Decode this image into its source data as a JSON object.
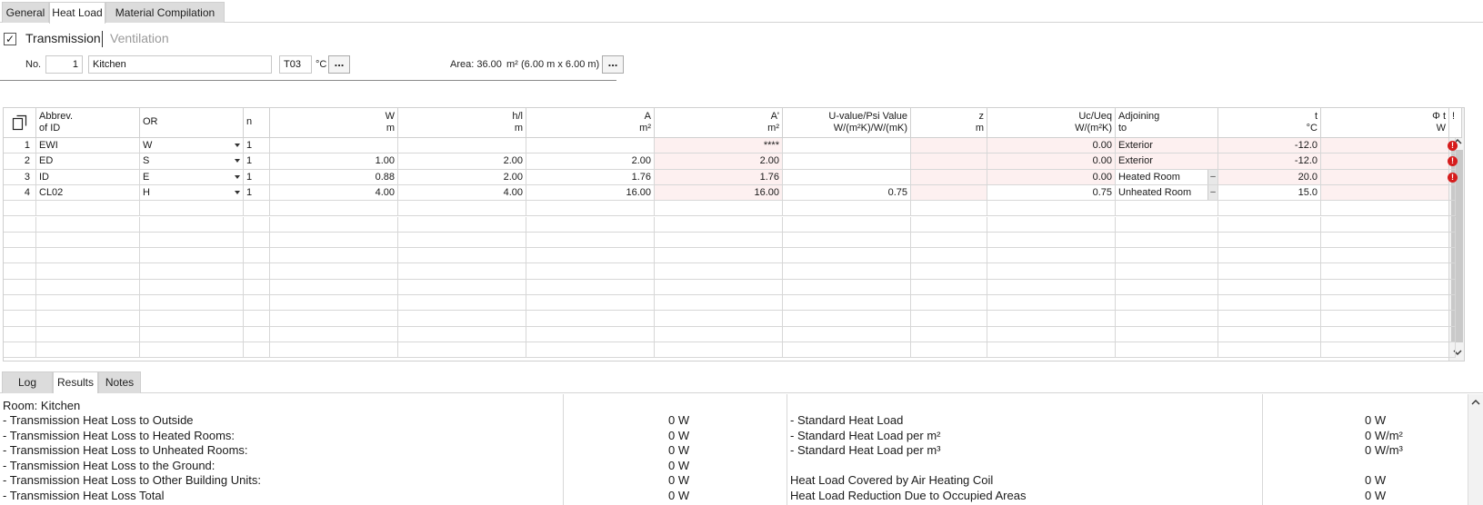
{
  "tabs": [
    "General",
    "Heat Load",
    "Material Compilation"
  ],
  "subtabs": {
    "transmission": "Transmission",
    "ventilation": "Ventilation",
    "checkbox": "✓"
  },
  "room": {
    "no_label": "No.",
    "no": "1",
    "name": "Kitchen",
    "temp_code": "T03",
    "temp_unit": "°C",
    "dots": "...",
    "area_label": "Area: 36.00",
    "area_unit": "m²",
    "area_dims": "(6.00 m x 6.00 m)"
  },
  "grid": {
    "copy_icon": "copy-icon",
    "headers": [
      {
        "l1": "Abbrev.",
        "l2": "of ID"
      },
      {
        "l1": "OR",
        "l2": ""
      },
      {
        "l1": "n",
        "l2": ""
      },
      {
        "l1": "W",
        "l2": "m"
      },
      {
        "l1": "h/l",
        "l2": "m"
      },
      {
        "l1": "A",
        "l2": "m²"
      },
      {
        "l1": "A'",
        "l2": "m²"
      },
      {
        "l1": "U-value/Psi Value",
        "l2": "W/(m²K)/W/(mK)"
      },
      {
        "l1": "z",
        "l2": "m"
      },
      {
        "l1": "Uc/Ueq",
        "l2": "W/(m²K)"
      },
      {
        "l1": "Adjoining",
        "l2": "to"
      },
      {
        "l1": "t",
        "l2": "°C"
      },
      {
        "l1": "Φ t",
        "l2": "W"
      },
      {
        "l1": "!",
        "l2": ""
      }
    ],
    "rows": [
      {
        "no": "1",
        "id": "EWI",
        "or": "W",
        "n": "1",
        "w": "",
        "h": "",
        "a": "",
        "a2": "****",
        "u": "",
        "z": "",
        "uc": "0.00",
        "adj": "Exterior",
        "t": "-12.0",
        "phi": "",
        "err": "!"
      },
      {
        "no": "2",
        "id": "ED",
        "or": "S",
        "n": "1",
        "w": "1.00",
        "h": "2.00",
        "a": "2.00",
        "a2": "2.00",
        "u": "",
        "z": "",
        "uc": "0.00",
        "adj": "Exterior",
        "t": "-12.0",
        "phi": "",
        "err": "!"
      },
      {
        "no": "3",
        "id": "ID",
        "or": "E",
        "n": "1",
        "w": "0.88",
        "h": "2.00",
        "a": "1.76",
        "a2": "1.76",
        "u": "",
        "z": "",
        "uc": "0.00",
        "adj": "Heated Room",
        "t": "20.0",
        "phi": "",
        "err": "!"
      },
      {
        "no": "4",
        "id": "CL02",
        "or": "H",
        "n": "1",
        "w": "4.00",
        "h": "4.00",
        "a": "16.00",
        "a2": "16.00",
        "u": "0.75",
        "z": "",
        "uc": "0.75",
        "adj": "Unheated Room",
        "t": "15.0",
        "phi": "",
        "err": ""
      }
    ],
    "minus": "–"
  },
  "bottom_tabs": [
    "Log",
    "Results",
    "Notes"
  ],
  "results": {
    "room_line": "Room: Kitchen",
    "left": [
      {
        "label": "- Transmission Heat Loss to Outside",
        "value": "0 W"
      },
      {
        "label": "- Transmission Heat Loss to Heated Rooms:",
        "value": "0 W"
      },
      {
        "label": "- Transmission Heat Loss to Unheated Rooms:",
        "value": "0 W"
      },
      {
        "label": "- Transmission Heat Loss to the Ground:",
        "value": "0 W"
      },
      {
        "label": "- Transmission Heat Loss to Other Building Units:",
        "value": "0 W"
      },
      {
        "label": "- Transmission Heat Loss Total",
        "value": "0 W"
      }
    ],
    "right": [
      {
        "label": "- Standard Heat Load",
        "value": "0 W"
      },
      {
        "label": "- Standard Heat Load per m²",
        "value": "0 W/m²"
      },
      {
        "label": "- Standard Heat Load per m³",
        "value": "0 W/m³"
      },
      {
        "label": "",
        "value": ""
      },
      {
        "label": "Heat Load Covered by Air Heating Coil",
        "value": "0 W"
      },
      {
        "label": "Heat Load Reduction Due to Occupied Areas",
        "value": "0 W"
      }
    ]
  },
  "colors": {
    "accent": "#d61c1c",
    "row_pink": "#fdf0f0",
    "tab_bg": "#dcdcdc"
  }
}
